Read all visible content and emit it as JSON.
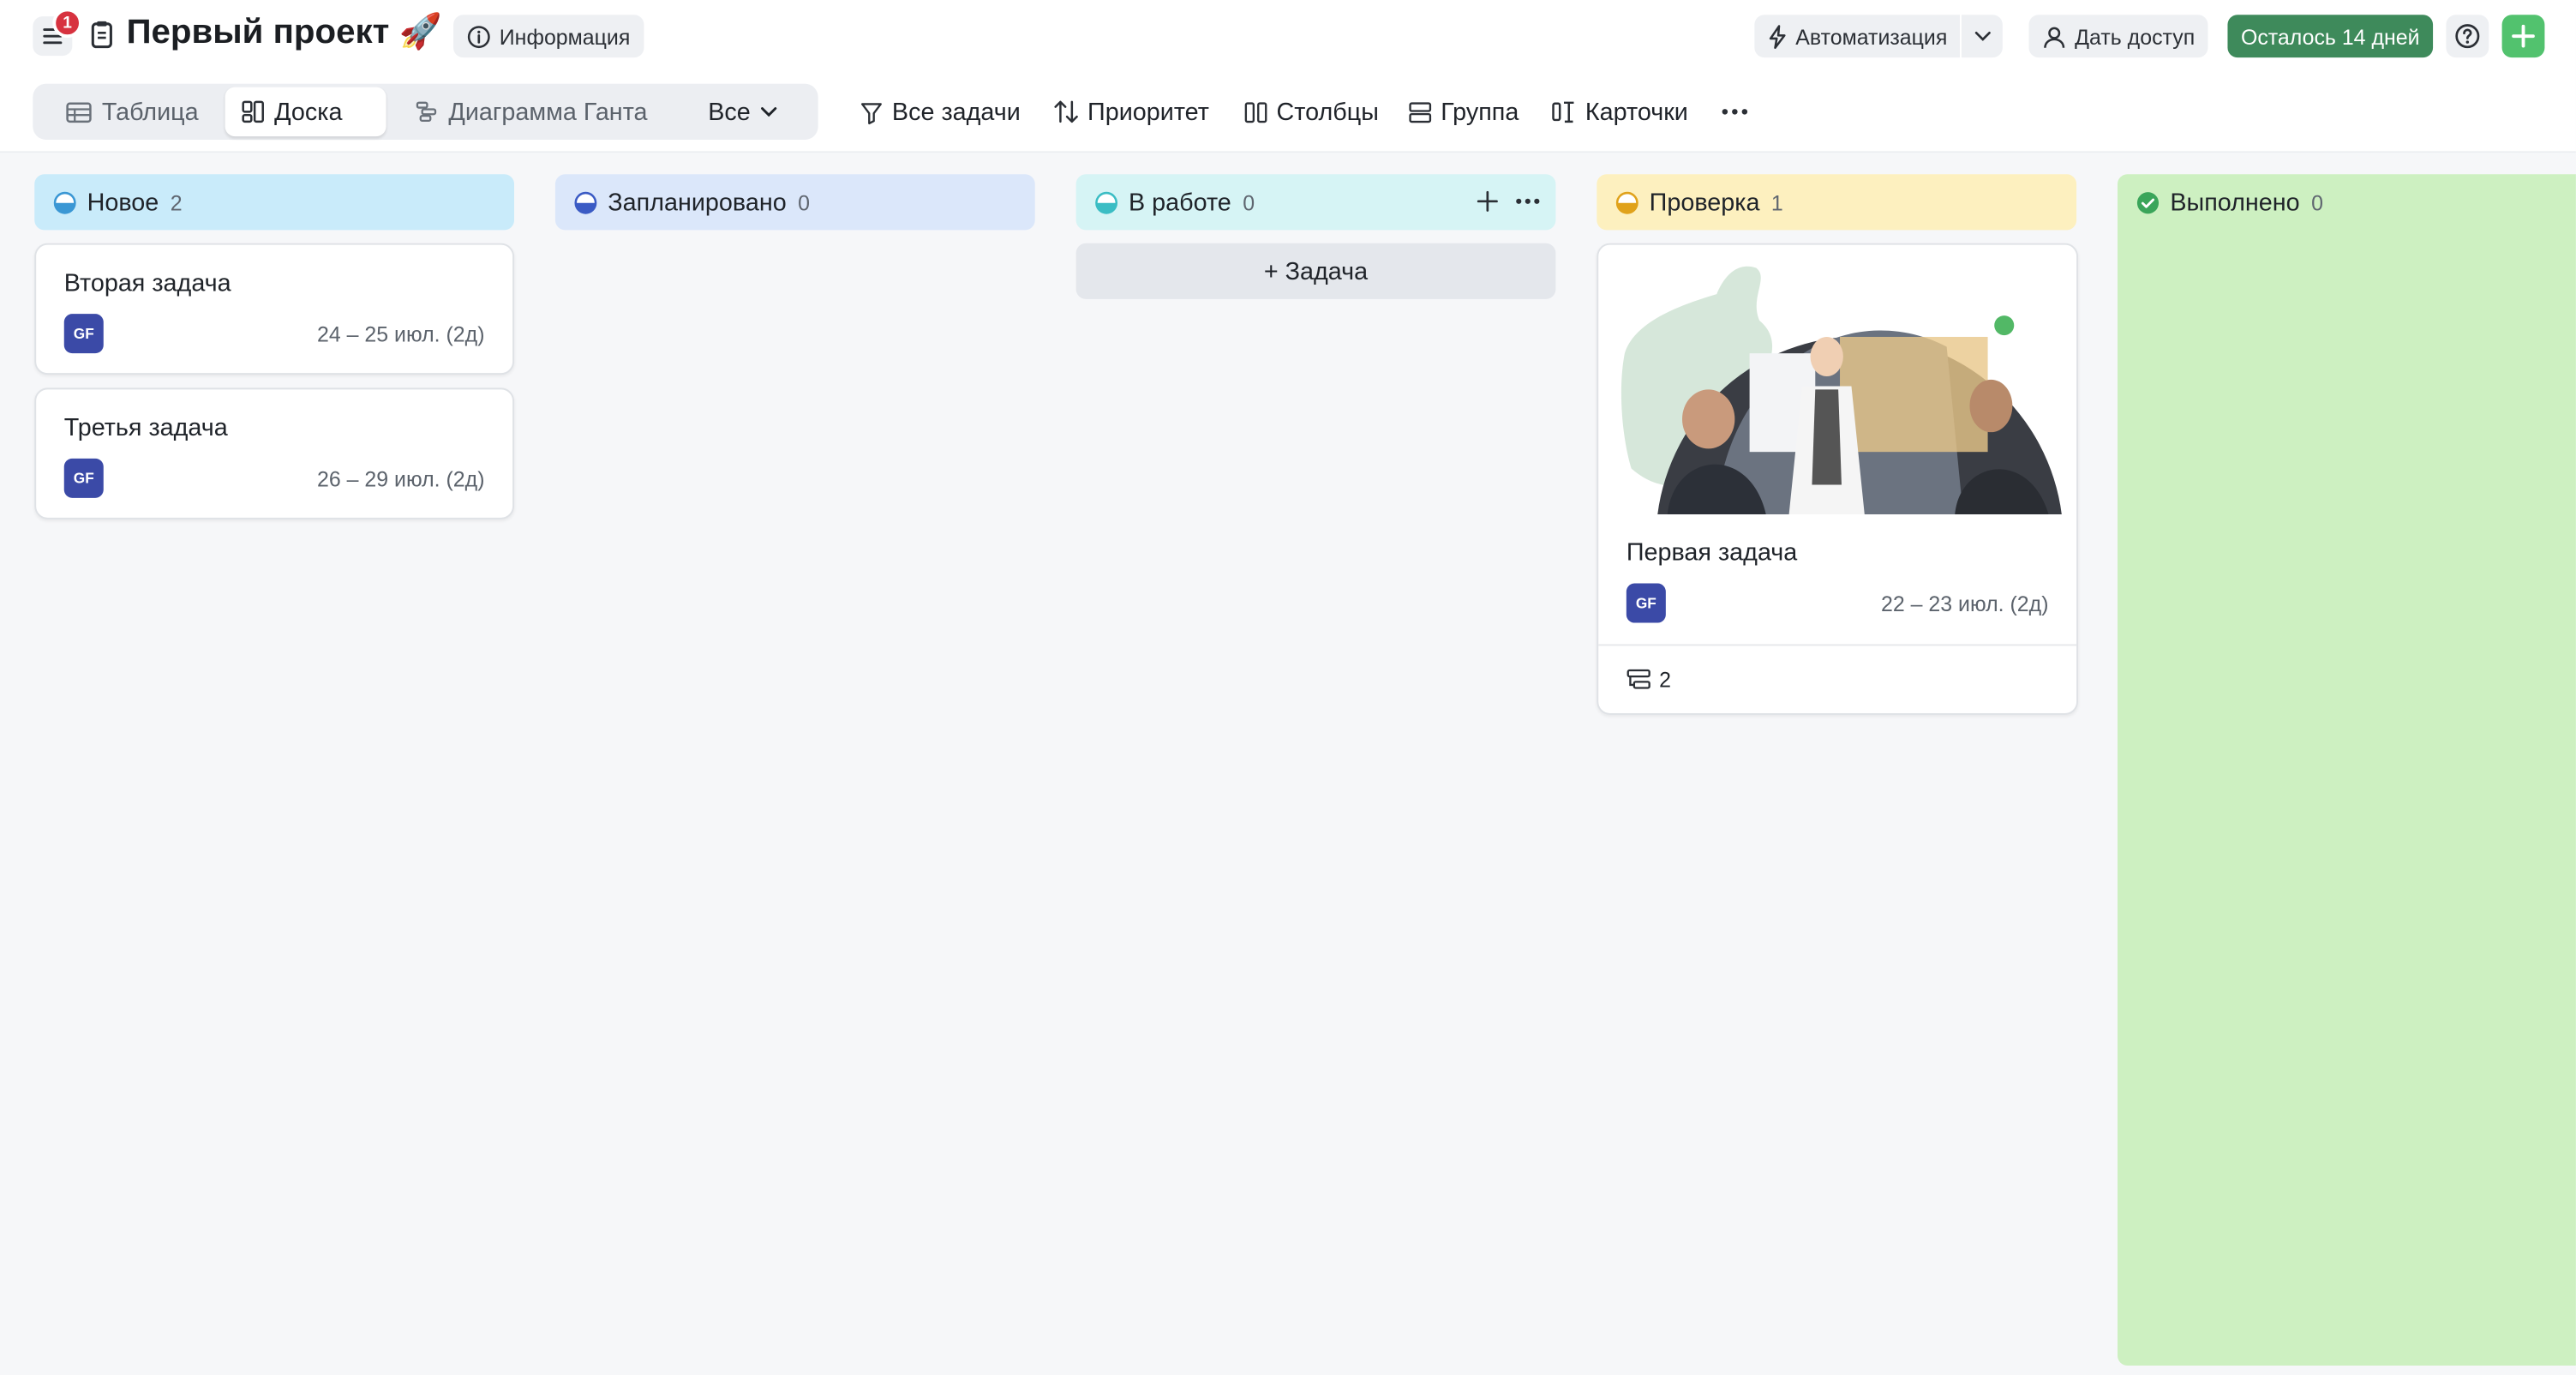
{
  "header": {
    "notification_count": "1",
    "project_title": "Первый проект 🚀",
    "info_label": "Информация",
    "automation_label": "Автоматизация",
    "share_label": "Дать доступ",
    "trial_label": "Осталось 14 дней"
  },
  "views": {
    "tabs": [
      {
        "label": "Таблица",
        "icon": "table-icon"
      },
      {
        "label": "Доска",
        "icon": "board-icon",
        "active": true
      },
      {
        "label": "Диаграмма Ганта",
        "icon": "gantt-icon"
      }
    ],
    "filter_select": "Все"
  },
  "toolbar": {
    "all_tasks": "Все задачи",
    "priority": "Приоритет",
    "columns": "Столбцы",
    "group": "Группа",
    "cards": "Карточки"
  },
  "columns": [
    {
      "title": "Новое",
      "count": "2",
      "color": "#c9ebfa",
      "icon_color": "#3a97d4",
      "cards": [
        {
          "title": "Вторая задача",
          "avatar": "GF",
          "date": "24 – 25 июл. (2д)"
        },
        {
          "title": "Третья задача",
          "avatar": "GF",
          "date": "26 – 29 июл. (2д)"
        }
      ]
    },
    {
      "title": "Запланировано",
      "count": "0",
      "color": "#dbe7fa",
      "icon_color": "#3b5bc4",
      "cards": []
    },
    {
      "title": "В работе",
      "count": "0",
      "color": "#d6f4f5",
      "icon_color": "#3bbdc4",
      "add_task_label": "+ Задача",
      "cards": []
    },
    {
      "title": "Проверка",
      "count": "1",
      "color": "#fdf0bf",
      "icon_color": "#e0a21b",
      "cards": [
        {
          "title": "Первая задача",
          "avatar": "GF",
          "date": "22 – 23 июл. (2д)",
          "subtasks": "2",
          "has_cover": true
        }
      ]
    },
    {
      "title": "Выполнено",
      "count": "0",
      "color": "#cdf0c1",
      "icon_color": "#3aa55a",
      "cards": []
    }
  ]
}
